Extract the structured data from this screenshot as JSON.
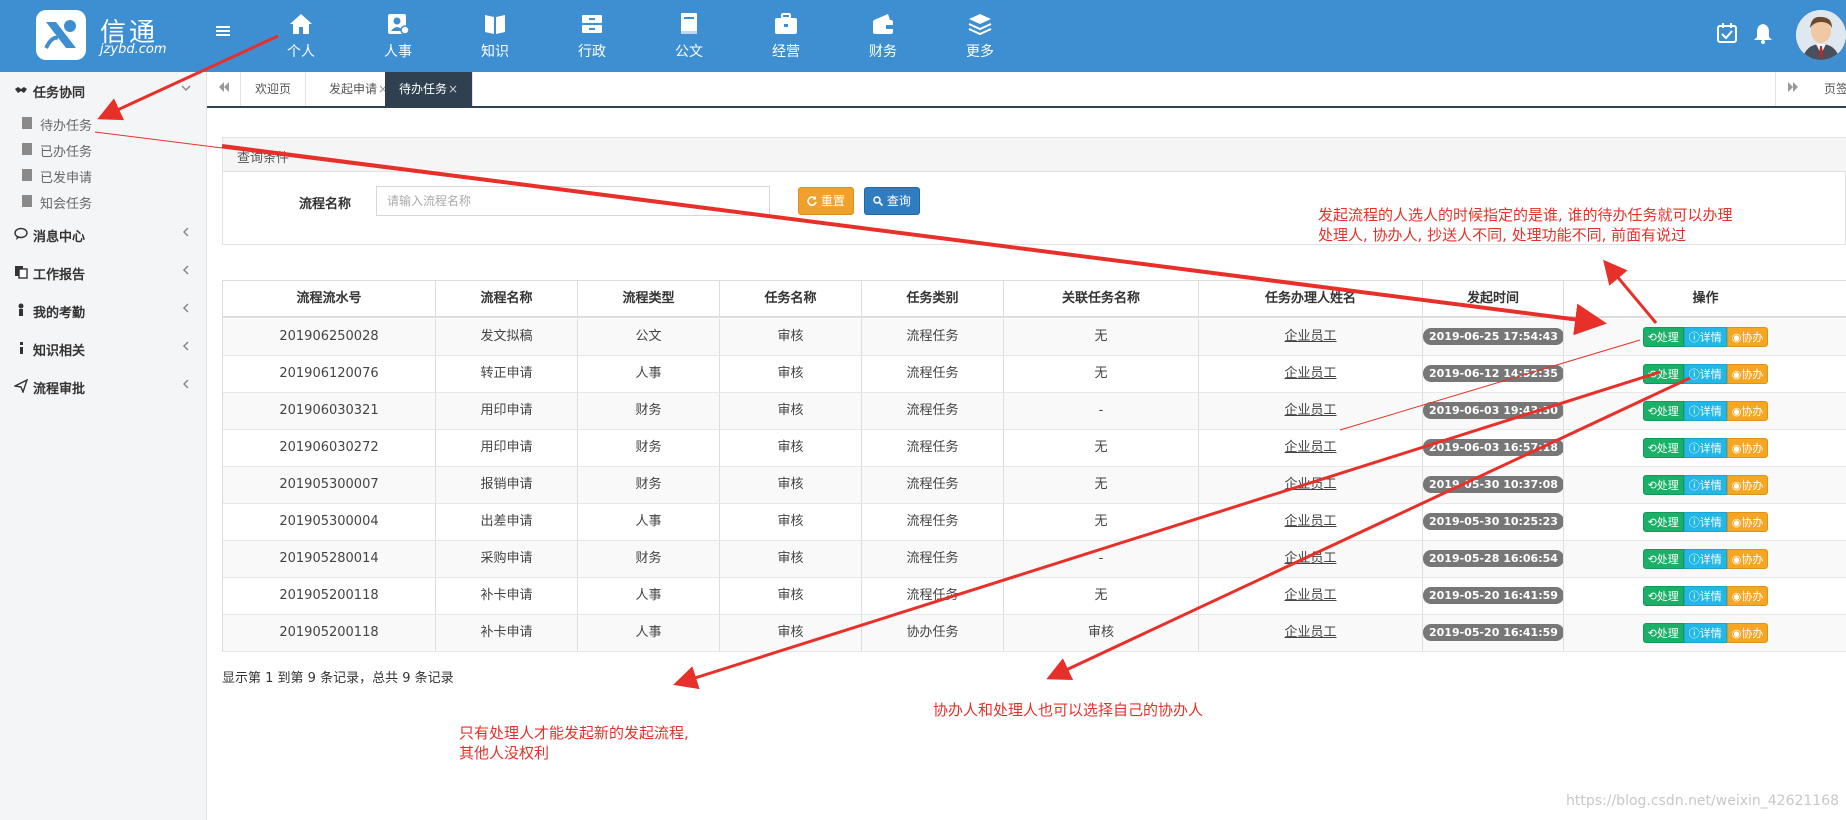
{
  "header": {
    "logo_title": "信通",
    "logo_sub": "jzybd.com",
    "nav": [
      {
        "label": "个人",
        "icon": "home-icon"
      },
      {
        "label": "人事",
        "icon": "personnel-icon"
      },
      {
        "label": "知识",
        "icon": "book-icon"
      },
      {
        "label": "行政",
        "icon": "cabinet-icon"
      },
      {
        "label": "公文",
        "icon": "document-icon"
      },
      {
        "label": "经营",
        "icon": "briefcase-icon"
      },
      {
        "label": "财务",
        "icon": "wallet-icon"
      },
      {
        "label": "更多",
        "icon": "layers-icon"
      }
    ],
    "right_icons": [
      "calendar-check-icon",
      "bell-icon"
    ],
    "accent_color": "#3d8fd1"
  },
  "sidebar": {
    "groups": [
      {
        "label": "任务协同",
        "icon": "handshake-icon",
        "expanded": true,
        "items": [
          "待办任务",
          "已办任务",
          "已发申请",
          "知会任务"
        ]
      },
      {
        "label": "消息中心",
        "icon": "comment-icon"
      },
      {
        "label": "工作报告",
        "icon": "copy-icon"
      },
      {
        "label": "我的考勤",
        "icon": "user-icon"
      },
      {
        "label": "知识相关",
        "icon": "info-icon"
      },
      {
        "label": "流程审批",
        "icon": "send-icon"
      }
    ]
  },
  "tabs": {
    "items": [
      {
        "label": "欢迎页",
        "closable": false,
        "active": false
      },
      {
        "label": "发起申请",
        "closable": true,
        "active": false
      },
      {
        "label": "待办任务",
        "closable": true,
        "active": true
      }
    ],
    "close_glyph": "×",
    "right_label": "页签操作"
  },
  "query": {
    "title": "查询条件",
    "field_label": "流程名称",
    "field_placeholder": "请输入流程名称",
    "field_value": "",
    "reset_label": "重置",
    "search_label": "查询"
  },
  "table": {
    "headers": [
      "流程流水号",
      "流程名称",
      "流程类型",
      "任务名称",
      "任务类别",
      "关联任务名称",
      "任务办理人姓名",
      "发起时间",
      "操作"
    ],
    "rows": [
      [
        "201906250028",
        "发文拟稿",
        "公文",
        "审核",
        "流程任务",
        "无",
        "企业员工",
        "2019-06-25 17:54:43"
      ],
      [
        "201906120076",
        "转正申请",
        "人事",
        "审核",
        "流程任务",
        "无",
        "企业员工",
        "2019-06-12 14:52:35"
      ],
      [
        "201906030321",
        "用印申请",
        "财务",
        "审核",
        "流程任务",
        "-",
        "企业员工",
        "2019-06-03 19:43:50"
      ],
      [
        "201906030272",
        "用印申请",
        "财务",
        "审核",
        "流程任务",
        "无",
        "企业员工",
        "2019-06-03 16:57:18"
      ],
      [
        "201905300007",
        "报销申请",
        "财务",
        "审核",
        "流程任务",
        "无",
        "企业员工",
        "2019-05-30 10:37:08"
      ],
      [
        "201905300004",
        "出差申请",
        "人事",
        "审核",
        "流程任务",
        "无",
        "企业员工",
        "2019-05-30 10:25:23"
      ],
      [
        "201905280014",
        "采购申请",
        "财务",
        "审核",
        "流程任务",
        "-",
        "企业员工",
        "2019-05-28 16:06:54"
      ],
      [
        "201905200118",
        "补卡申请",
        "人事",
        "审核",
        "流程任务",
        "无",
        "企业员工",
        "2019-05-20 16:41:59"
      ],
      [
        "201905200118",
        "补卡申请",
        "人事",
        "审核",
        "协办任务",
        "审核",
        "企业员工",
        "2019-05-20 16:41:59"
      ]
    ],
    "actions": {
      "handle": "处理",
      "detail": "详情",
      "assist": "协办"
    },
    "footer": "显示第 1 到第 9 条记录，总共 9 条记录"
  },
  "annotations": {
    "top_right": [
      "发起流程的人选人的时候指定的是谁, 谁的待办任务就可以办理",
      "处理人, 协办人, 抄送人不同, 处理功能不同, 前面有说过"
    ],
    "bottom_left": [
      "只有处理人才能发起新的发起流程,",
      "其他人没权利"
    ],
    "bottom_center": "协办人和处理人也可以选择自己的协办人",
    "color": "#e8302a"
  },
  "watermark": "https://blog.csdn.net/weixin_42621168"
}
